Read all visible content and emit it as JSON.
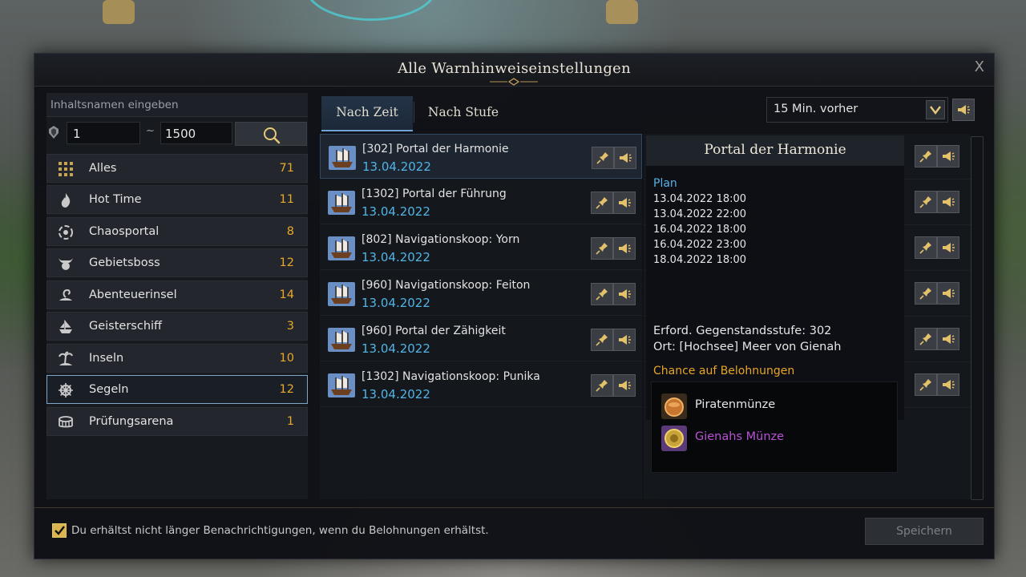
{
  "window": {
    "title": "Alle Warnhinweiseinstellungen",
    "close_label": "X"
  },
  "filter": {
    "search_placeholder": "Inhaltsnamen eingeben",
    "range_min": "1",
    "range_sep": "~",
    "range_max": "1500"
  },
  "categories": [
    {
      "label": "Alles",
      "count": "71",
      "icon": "grid-icon"
    },
    {
      "label": "Hot Time",
      "count": "11",
      "icon": "flame-icon"
    },
    {
      "label": "Chaosportal",
      "count": "8",
      "icon": "vortex-icon"
    },
    {
      "label": "Gebietsboss",
      "count": "12",
      "icon": "horned-skull-icon"
    },
    {
      "label": "Abenteuerinsel",
      "count": "14",
      "icon": "island-swirl-icon"
    },
    {
      "label": "Geisterschiff",
      "count": "3",
      "icon": "ghost-ship-icon"
    },
    {
      "label": "Inseln",
      "count": "10",
      "icon": "palm-island-icon"
    },
    {
      "label": "Segeln",
      "count": "12",
      "icon": "ship-wheel-icon",
      "selected": true
    },
    {
      "label": "Prüfungsarena",
      "count": "1",
      "icon": "arena-icon"
    }
  ],
  "tabs": {
    "active": "Nach Zeit",
    "inactive": "Nach Stufe"
  },
  "time_select": {
    "value": "15 Min. vorher"
  },
  "events": [
    {
      "title": "[302] Portal der Harmonie",
      "date": "13.04.2022",
      "selected": true
    },
    {
      "title": "[1302] Portal der Führung",
      "date": "13.04.2022"
    },
    {
      "title": "[802] Navigationskoop: Yorn",
      "date": "13.04.2022"
    },
    {
      "title": "[960] Navigationskoop: Feiton",
      "date": "13.04.2022"
    },
    {
      "title": "[960] Portal der Zähigkeit",
      "date": "13.04.2022"
    },
    {
      "title": "[1302] Navigationskoop: Punika",
      "date": "13.04.2022"
    }
  ],
  "detail": {
    "title": "Portal der Harmonie",
    "plan_label": "Plan",
    "schedule": [
      "13.04.2022 18:00",
      "13.04.2022 22:00",
      "16.04.2022 18:00",
      "16.04.2022 23:00",
      "18.04.2022 18:00"
    ],
    "item_level": "Erford. Gegenstandsstufe: 302",
    "location": "Ort: [Hochsee] Meer von Gienah",
    "rewards_label": "Chance auf Belohnungen",
    "rewards": [
      {
        "name": "Piratenmünze",
        "color": "#e6e6e6"
      },
      {
        "name": "Gienahs Münze",
        "color": "#b852d6"
      }
    ]
  },
  "footer": {
    "checkbox_label": "Du erhältst nicht länger Benachrichtigungen, wenn du Belohnungen erhältst.",
    "checkbox_checked": true,
    "save_label": "Speichern"
  },
  "colors": {
    "accent_gold": "#e8a92b",
    "date_blue": "#52b4e6",
    "purple": "#b852d6"
  }
}
